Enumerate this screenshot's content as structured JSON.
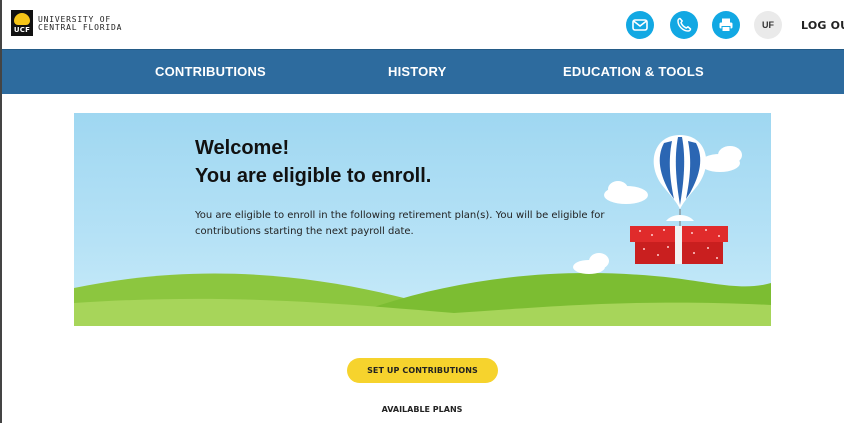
{
  "header": {
    "logo_abbr": "UCF",
    "org_line1": "UNIVERSITY OF",
    "org_line2": "CENTRAL FLORIDA",
    "user_initials": "UF",
    "logout_label": "LOG OUT",
    "icons": [
      "mail-icon",
      "phone-icon",
      "print-icon"
    ],
    "icon_color": "#12a8e3"
  },
  "nav": {
    "items": [
      {
        "label": "CONTRIBUTIONS"
      },
      {
        "label": "HISTORY"
      },
      {
        "label": "EDUCATION & TOOLS"
      }
    ],
    "bg_color": "#2d6b9e"
  },
  "hero": {
    "title_line1": "Welcome!",
    "title_line2": "You are eligible to enroll.",
    "body": "You are eligible to enroll in the following retirement plan(s). You will be eligible for contributions starting the next payroll date."
  },
  "cta": {
    "label": "SET UP CONTRIBUTIONS",
    "color": "#f6d32d"
  },
  "plans": {
    "heading": "AVAILABLE PLANS"
  }
}
